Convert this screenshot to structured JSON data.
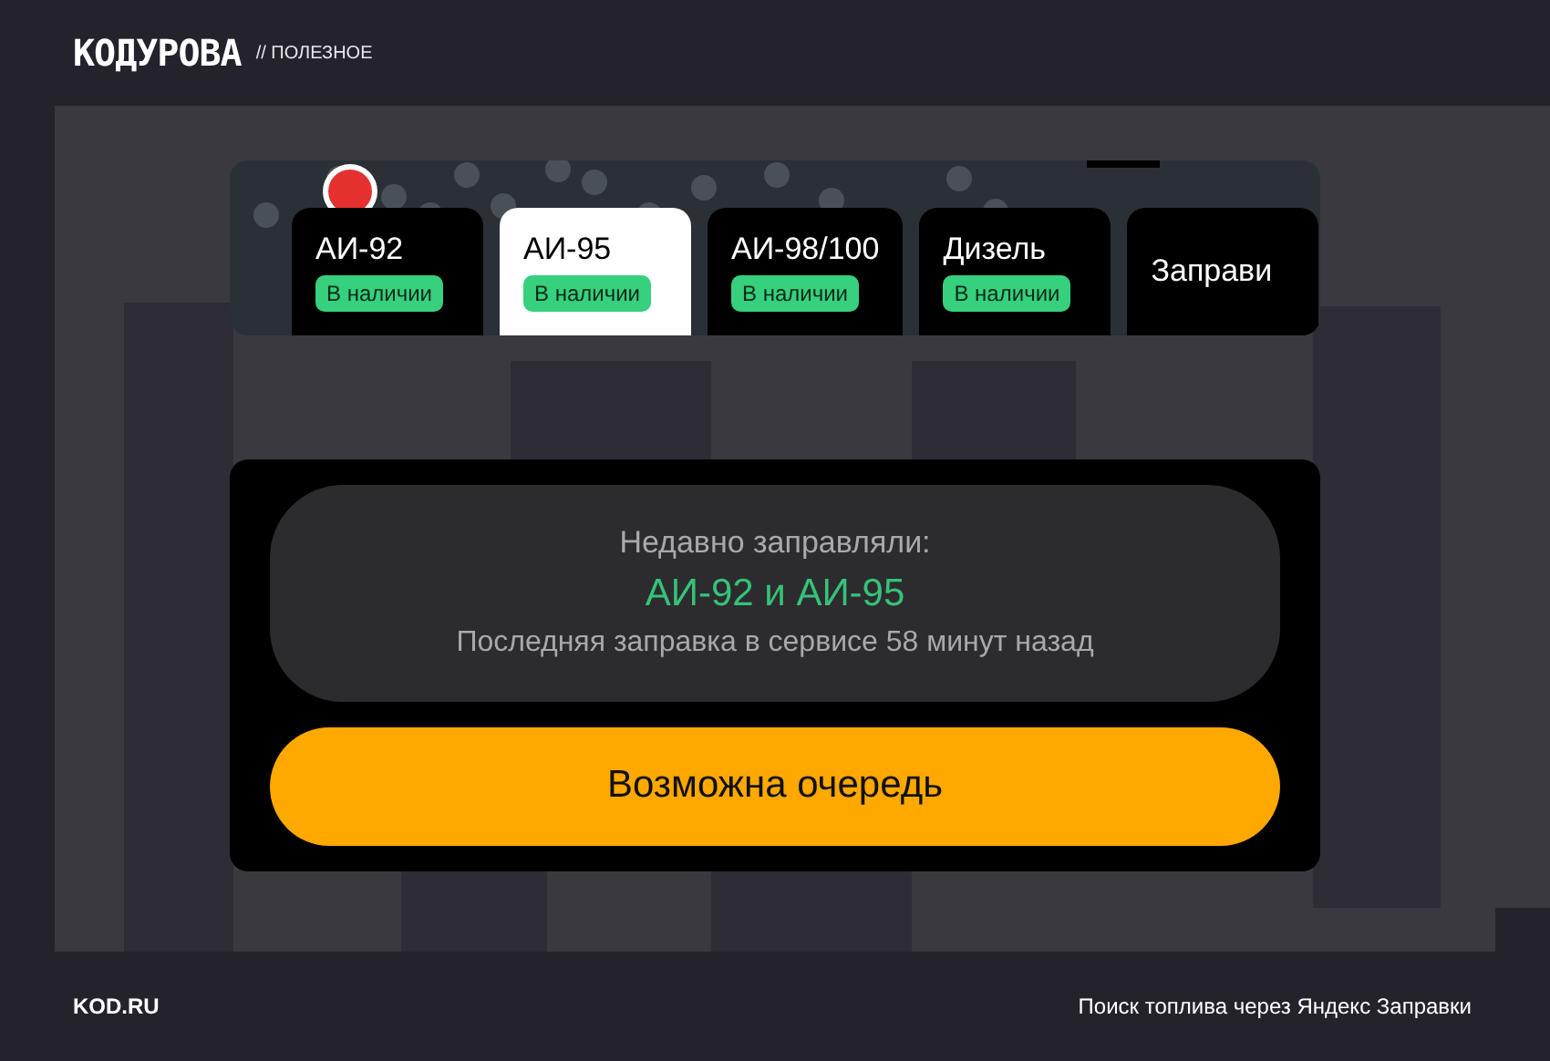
{
  "header": {
    "logo": "КОДУРОВА",
    "section": "// ПОЛЕЗНОЕ"
  },
  "fuel_tabs": [
    {
      "kind": "fuel",
      "label": "АИ-92",
      "status": "В наличии",
      "selected": false
    },
    {
      "kind": "fuel",
      "label": "АИ-95",
      "status": "В наличии",
      "selected": true
    },
    {
      "kind": "fuel",
      "label": "АИ-98/100",
      "status": "В наличии",
      "selected": false
    },
    {
      "kind": "fuel",
      "label": "Дизель",
      "status": "В наличии",
      "selected": false
    },
    {
      "kind": "service",
      "label": "Заправи",
      "selected": false
    }
  ],
  "recent": {
    "title": "Недавно заправляли:",
    "fuels": "АИ-92 и АИ-95",
    "note": "Последняя заправка в сервисе 58 минут назад"
  },
  "queue_button": "Возможна очередь",
  "footer": {
    "site": "KOD.RU",
    "caption": "Поиск топлива через Яндекс Заправки"
  }
}
